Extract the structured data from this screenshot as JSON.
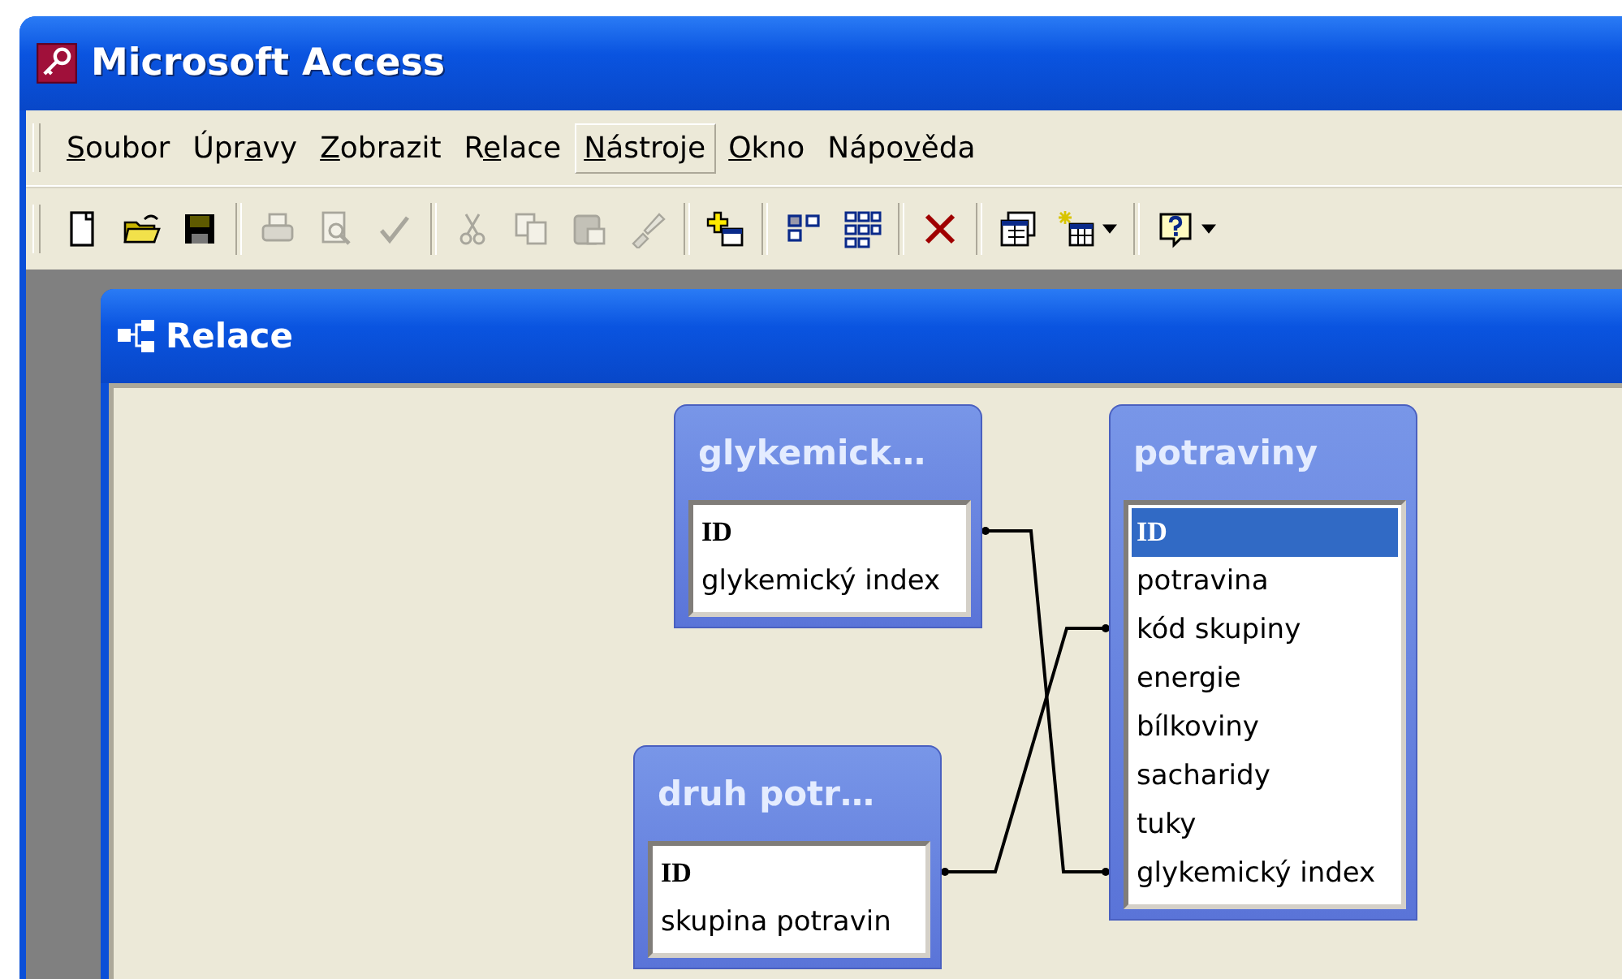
{
  "window": {
    "title": "Microsoft Access"
  },
  "menu": [
    {
      "key": "S",
      "after": "oubor",
      "highlighted": false
    },
    {
      "before": "Úpr",
      "key": "a",
      "after": "vy",
      "highlighted": false
    },
    {
      "key": "Z",
      "after": "obrazit",
      "highlighted": false
    },
    {
      "before": "R",
      "key": "e",
      "after": "lace",
      "highlighted": false
    },
    {
      "key": "N",
      "after": "ástroje",
      "highlighted": true
    },
    {
      "key": "O",
      "after": "kno",
      "highlighted": false
    },
    {
      "before": "Nápo",
      "key": "v",
      "after": "ěda",
      "highlighted": false
    }
  ],
  "toolbar": [
    {
      "kind": "button",
      "disabled": false,
      "dropdown": false
    },
    {
      "kind": "button",
      "disabled": false,
      "dropdown": false
    },
    {
      "kind": "button",
      "disabled": false,
      "dropdown": false
    },
    {
      "kind": "separator"
    },
    {
      "kind": "button",
      "disabled": true,
      "dropdown": false
    },
    {
      "kind": "button",
      "disabled": true,
      "dropdown": false
    },
    {
      "kind": "button",
      "disabled": true,
      "dropdown": false
    },
    {
      "kind": "separator"
    },
    {
      "kind": "button",
      "disabled": true,
      "dropdown": false
    },
    {
      "kind": "button",
      "disabled": true,
      "dropdown": false
    },
    {
      "kind": "button",
      "disabled": true,
      "dropdown": false
    },
    {
      "kind": "button",
      "disabled": true,
      "dropdown": false
    },
    {
      "kind": "separator"
    },
    {
      "kind": "button",
      "disabled": false,
      "dropdown": false
    },
    {
      "kind": "separator"
    },
    {
      "kind": "button",
      "disabled": false,
      "dropdown": false
    },
    {
      "kind": "button",
      "disabled": false,
      "dropdown": false
    },
    {
      "kind": "separator"
    },
    {
      "kind": "button",
      "disabled": false,
      "dropdown": false
    },
    {
      "kind": "separator"
    },
    {
      "kind": "button",
      "disabled": false,
      "dropdown": false
    },
    {
      "kind": "button",
      "disabled": false,
      "dropdown": true
    },
    {
      "kind": "separator"
    },
    {
      "kind": "button",
      "disabled": false,
      "dropdown": true
    }
  ],
  "child_window": {
    "title": "Relace"
  },
  "tables": [
    {
      "title": "glykemick…",
      "fields": [
        {
          "name": "ID",
          "primary_key": true,
          "selected": false
        },
        {
          "name": "glykemický index",
          "primary_key": false,
          "selected": false
        }
      ]
    },
    {
      "title": "potraviny",
      "fields": [
        {
          "name": "ID",
          "primary_key": true,
          "selected": true
        },
        {
          "name": "potravina",
          "primary_key": false,
          "selected": false
        },
        {
          "name": "kód skupiny",
          "primary_key": false,
          "selected": false
        },
        {
          "name": "energie",
          "primary_key": false,
          "selected": false
        },
        {
          "name": "bílkoviny",
          "primary_key": false,
          "selected": false
        },
        {
          "name": "sacharidy",
          "primary_key": false,
          "selected": false
        },
        {
          "name": "tuky",
          "primary_key": false,
          "selected": false
        },
        {
          "name": "glykemický index",
          "primary_key": false,
          "selected": false
        }
      ]
    },
    {
      "title": "druh potr…",
      "fields": [
        {
          "name": "ID",
          "primary_key": true,
          "selected": false
        },
        {
          "name": "skupina potravin",
          "primary_key": false,
          "selected": false
        }
      ]
    }
  ]
}
